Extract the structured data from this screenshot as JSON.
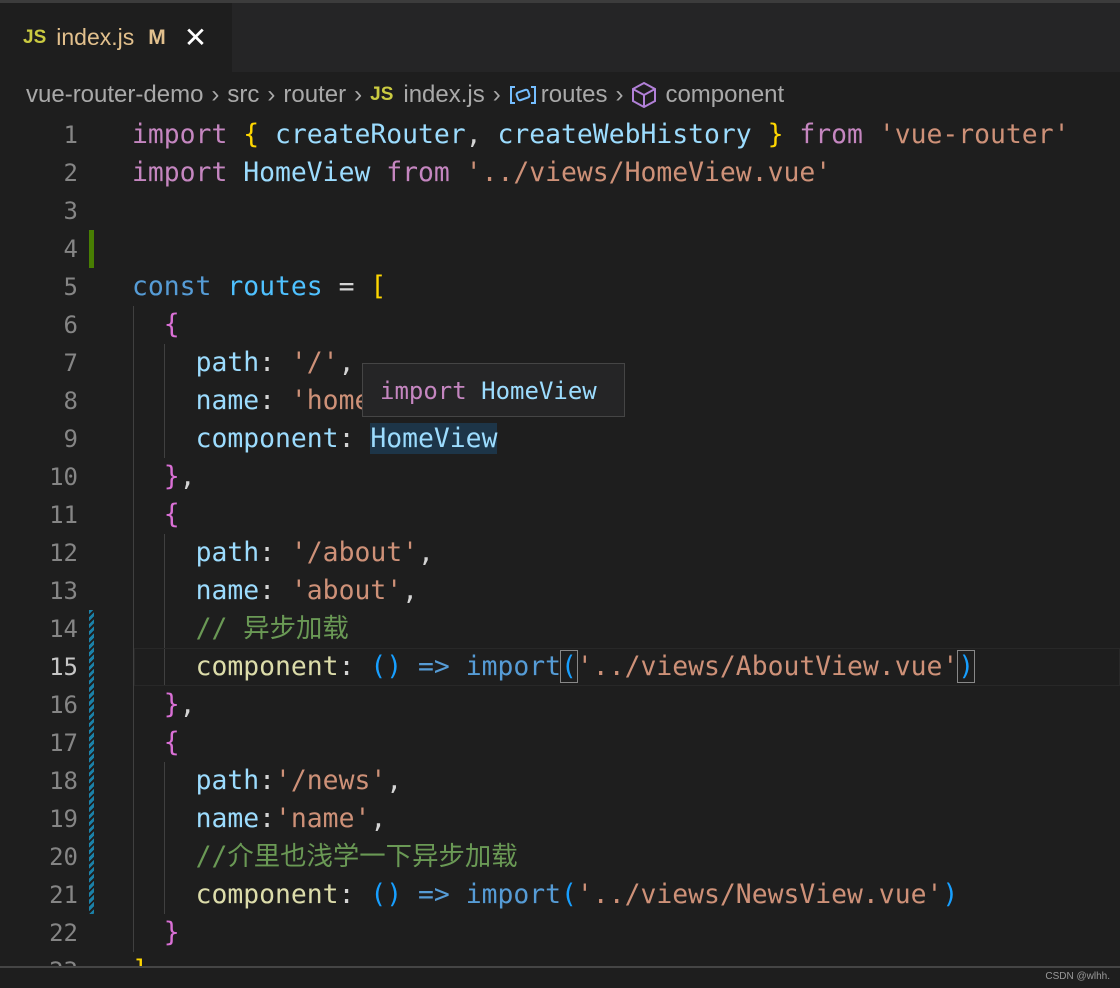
{
  "tab": {
    "icon": "JS",
    "name": "index.js",
    "status": "M",
    "close": "✕"
  },
  "breadcrumb": [
    {
      "label": "vue-router-demo"
    },
    {
      "label": "src"
    },
    {
      "label": "router"
    },
    {
      "label": "index.js",
      "icon": "JS"
    },
    {
      "label": "routes",
      "icon": "variable-icon"
    },
    {
      "label": "component",
      "icon": "cube-icon"
    }
  ],
  "breadcrumb_sep": "›",
  "editor": {
    "current_line": 15,
    "lines": [
      [
        [
          "import",
          "kw"
        ],
        [
          " ",
          "pl"
        ],
        [
          "{",
          "b1"
        ],
        [
          " ",
          "pl"
        ],
        [
          "createRouter",
          "var"
        ],
        [
          ", ",
          "pl"
        ],
        [
          "createWebHistory",
          "var"
        ],
        [
          " ",
          "pl"
        ],
        [
          "}",
          "b1"
        ],
        [
          " ",
          "pl"
        ],
        [
          "from",
          "kw"
        ],
        [
          " ",
          "pl"
        ],
        [
          "'vue-router'",
          "str"
        ]
      ],
      [
        [
          "import",
          "kw"
        ],
        [
          " ",
          "pl"
        ],
        [
          "HomeView",
          "var"
        ],
        [
          " ",
          "pl"
        ],
        [
          "from",
          "kw"
        ],
        [
          " ",
          "pl"
        ],
        [
          "'../views/HomeView.vue'",
          "str"
        ]
      ],
      [],
      [],
      [
        [
          "const",
          "kb"
        ],
        [
          " ",
          "pl"
        ],
        [
          "routes",
          "cst"
        ],
        [
          " = ",
          "pl"
        ],
        [
          "[",
          "b1"
        ]
      ],
      [
        [
          "  ",
          "pl"
        ],
        [
          "{",
          "b2"
        ]
      ],
      [
        [
          "    ",
          "pl"
        ],
        [
          "path",
          "var"
        ],
        [
          ": ",
          "pl"
        ],
        [
          "'/'",
          "str"
        ],
        [
          ",",
          "pl"
        ]
      ],
      [
        [
          "    ",
          "pl"
        ],
        [
          "name",
          "var"
        ],
        [
          ": ",
          "pl"
        ],
        [
          "'home'",
          "str"
        ],
        [
          ",",
          "pl"
        ]
      ],
      [
        [
          "    ",
          "pl"
        ],
        [
          "component",
          "var"
        ],
        [
          ": ",
          "pl"
        ],
        [
          "HomeView",
          "var hl"
        ]
      ],
      [
        [
          "  ",
          "pl"
        ],
        [
          "}",
          "b2"
        ],
        [
          ",",
          "pl"
        ]
      ],
      [
        [
          "  ",
          "pl"
        ],
        [
          "{",
          "b2"
        ]
      ],
      [
        [
          "    ",
          "pl"
        ],
        [
          "path",
          "var"
        ],
        [
          ": ",
          "pl"
        ],
        [
          "'/about'",
          "str"
        ],
        [
          ",",
          "pl"
        ]
      ],
      [
        [
          "    ",
          "pl"
        ],
        [
          "name",
          "var"
        ],
        [
          ": ",
          "pl"
        ],
        [
          "'about'",
          "str"
        ],
        [
          ",",
          "pl"
        ]
      ],
      [
        [
          "    ",
          "pl"
        ],
        [
          "// 异步加载",
          "cm"
        ]
      ],
      [
        [
          "    ",
          "pl"
        ],
        [
          "component",
          "fn"
        ],
        [
          ": ",
          "pl"
        ],
        [
          "()",
          "b3"
        ],
        [
          " ",
          "pl"
        ],
        [
          "=>",
          "kb"
        ],
        [
          " ",
          "pl"
        ],
        [
          "import",
          "kb"
        ],
        [
          "(",
          "b3 bm"
        ],
        [
          "'../views/AboutView.vue'",
          "str"
        ],
        [
          ")",
          "b3 bm"
        ]
      ],
      [
        [
          "  ",
          "pl"
        ],
        [
          "}",
          "b2"
        ],
        [
          ",",
          "pl"
        ]
      ],
      [
        [
          "  ",
          "pl"
        ],
        [
          "{",
          "b2"
        ]
      ],
      [
        [
          "    ",
          "pl"
        ],
        [
          "path",
          "var"
        ],
        [
          ":",
          "pl"
        ],
        [
          "'/news'",
          "str"
        ],
        [
          ",",
          "pl"
        ]
      ],
      [
        [
          "    ",
          "pl"
        ],
        [
          "name",
          "var"
        ],
        [
          ":",
          "pl"
        ],
        [
          "'name'",
          "str"
        ],
        [
          ",",
          "pl"
        ]
      ],
      [
        [
          "    ",
          "pl"
        ],
        [
          "//介里也浅学一下异步加载",
          "cm"
        ]
      ],
      [
        [
          "    ",
          "pl"
        ],
        [
          "component",
          "fn"
        ],
        [
          ": ",
          "pl"
        ],
        [
          "()",
          "b3"
        ],
        [
          " ",
          "pl"
        ],
        [
          "=>",
          "kb"
        ],
        [
          " ",
          "pl"
        ],
        [
          "import",
          "kb"
        ],
        [
          "(",
          "b3"
        ],
        [
          "'../views/NewsView.vue'",
          "str"
        ],
        [
          ")",
          "b3"
        ]
      ],
      [
        [
          "  ",
          "pl"
        ],
        [
          "}",
          "b2"
        ]
      ],
      [
        [
          "]",
          "b1"
        ]
      ]
    ]
  },
  "tooltip": {
    "keyword": "import",
    "name": "HomeView"
  },
  "watermark": "CSDN @wlhh."
}
